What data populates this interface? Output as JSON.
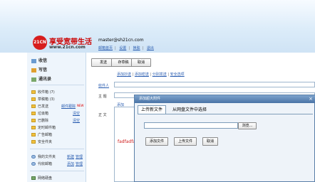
{
  "brand": {
    "logo_text": "21CN",
    "name": "享受宽带生活",
    "domain": "www.21cn.com"
  },
  "account": {
    "email": "master@sh21cn.com",
    "links": [
      "邮箱首页",
      "设置",
      "换肤",
      "退出"
    ]
  },
  "sidebar": {
    "inbox": "收信",
    "write": "写信",
    "contacts": "通讯录",
    "folders": [
      {
        "label": "收件箱 (7)",
        "action": ""
      },
      {
        "label": "草稿箱 (3)",
        "action": ""
      },
      {
        "label": "已发送",
        "action": "邮件跟踪",
        "badge": "NEW"
      },
      {
        "label": "垃圾箱",
        "action": "清空"
      },
      {
        "label": "已删除",
        "action": "清空"
      },
      {
        "label": "定时邮件箱",
        "action": ""
      },
      {
        "label": "广告邮箱",
        "action": ""
      },
      {
        "label": "安全件夹",
        "action": ""
      }
    ],
    "my_folders": {
      "label": "我的文件夹",
      "action1": "新建",
      "action2": "管理"
    },
    "agent_mail": {
      "label": "代收邮箱",
      "action1": "添加",
      "action2": "管理"
    },
    "netdisk": "网络硬盘"
  },
  "toolbar": {
    "send": "发送",
    "save_draft": "存草稿",
    "cancel": "取消"
  },
  "compose": {
    "links": [
      "添加抄送",
      "添加密送",
      "分别发送",
      "安全选项"
    ],
    "to_label": "收件人",
    "subject_label": "主  题",
    "body_label": "正  文",
    "attach_link": "添加",
    "body_text": "fadfadfasf"
  },
  "dialog": {
    "title": "添加超大附件",
    "close": "×",
    "tab_upload": "上传新文件",
    "tab_netdisk": "从网盘文件中选择",
    "browse": "浏览...",
    "add_file": "添加文件",
    "upload": "上传文件",
    "cancel": "取消"
  },
  "colors": {
    "accent": "#2a5db0",
    "brand_red": "#c00",
    "dialog_title": "#4a74a6"
  }
}
